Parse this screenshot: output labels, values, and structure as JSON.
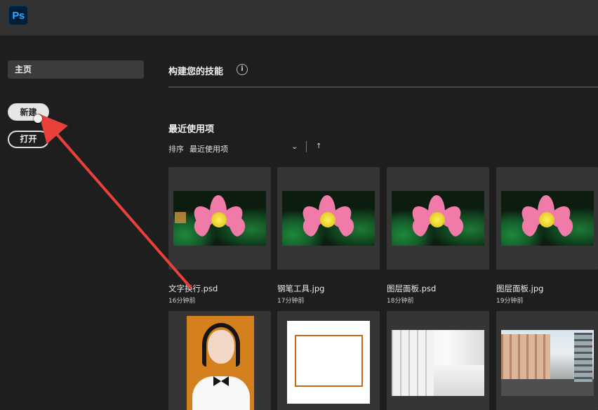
{
  "app": {
    "logo_text": "Ps"
  },
  "sidebar": {
    "home_label": "主页",
    "new_label": "新建",
    "open_label": "打开"
  },
  "main": {
    "skills_title": "构建您的技能",
    "info_icon": "i",
    "recent_title": "最近使用项",
    "sort_label": "排序",
    "sort_value": "最近使用项",
    "sort_chevron": "⌄",
    "sort_direction_icon": "↑"
  },
  "files": [
    {
      "name": "文字换行.psd",
      "time": "16分钟前",
      "thumb": "lotus"
    },
    {
      "name": "钢笔工具.jpg",
      "time": "17分钟前",
      "thumb": "lotus"
    },
    {
      "name": "图层面板.psd",
      "time": "18分钟前",
      "thumb": "lotus"
    },
    {
      "name": "图层面板.jpg",
      "time": "19分钟前",
      "thumb": "lotus"
    },
    {
      "name": "",
      "time": "",
      "thumb": "portrait"
    },
    {
      "name": "",
      "time": "",
      "thumb": "frame"
    },
    {
      "name": "",
      "time": "",
      "thumb": "street-sketch"
    },
    {
      "name": "",
      "time": "",
      "thumb": "street-photo"
    }
  ],
  "colors": {
    "annotation_arrow": "#e8413c",
    "frame_orange": "#c46a1a",
    "ps_blue": "#31a8ff"
  }
}
